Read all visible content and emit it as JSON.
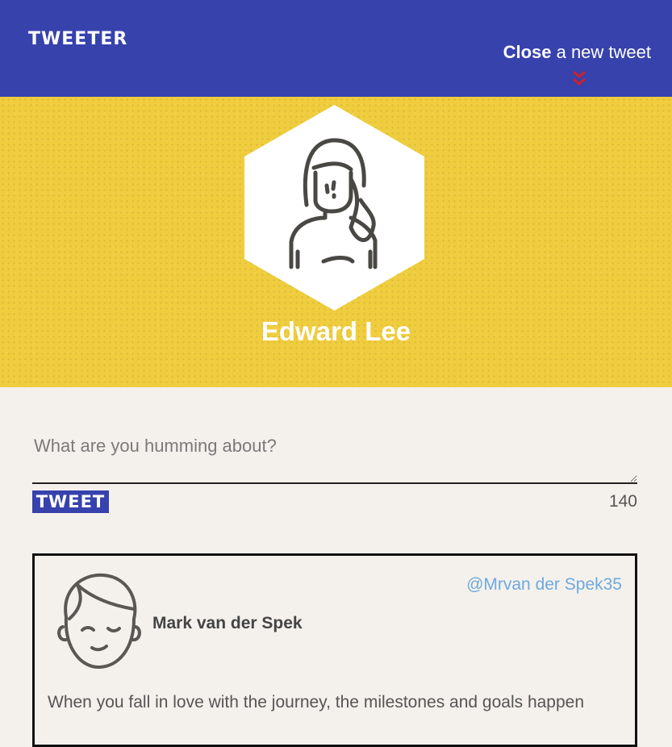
{
  "navbar": {
    "logo": "TWEETER",
    "toggle_action": "Close",
    "toggle_rest": " a new tweet",
    "chevron_color": "#d0202a"
  },
  "profile": {
    "name": "Edward Lee",
    "banner_color": "#efcd3e",
    "avatar_icon": "woman-avatar-icon"
  },
  "composer": {
    "placeholder": "What are you humming about?",
    "button_label": "TWEET",
    "counter": "140"
  },
  "tweets": [
    {
      "avatar_icon": "man-avatar-icon",
      "author": "Mark van der Spek",
      "handle": "@Mrvan der Spek35",
      "text": "When you fall in love with the journey, the milestones and goals happen"
    }
  ],
  "colors": {
    "primary": "#3742ad",
    "background": "#f4f1ec",
    "handle": "#6fa9de"
  }
}
